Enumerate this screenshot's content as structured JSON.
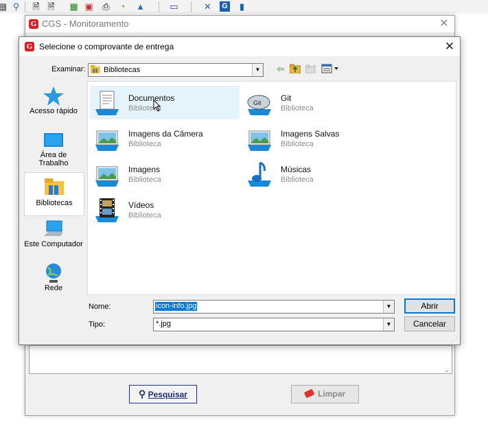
{
  "toolbar": {
    "icons": [
      "document-icon",
      "binoculars-icon",
      "doc-search-icon",
      "doc-gear-icon",
      "doc-report-icon",
      "printer-icon",
      "pie-chart-icon",
      "bell-icon",
      "monitor-icon",
      "tools-icon",
      "cgs-icon",
      "file-icon"
    ]
  },
  "background_window": {
    "title": "CGS - Monitoramento",
    "search_button": "Pesquisar",
    "clear_button": "Limpar"
  },
  "dialog": {
    "title": "Selecione o comprovante de entrega",
    "look_in_label": "Examinar:",
    "look_in_value": "Bibliotecas",
    "places": [
      {
        "label": "Acesso rápido",
        "icon": "star-icon"
      },
      {
        "label": "Área de\nTrabalho",
        "icon": "desktop-icon"
      },
      {
        "label": "Bibliotecas",
        "icon": "libraries-icon"
      },
      {
        "label": "Este Computador",
        "icon": "computer-icon"
      },
      {
        "label": "Rede",
        "icon": "network-icon"
      }
    ],
    "items": [
      {
        "name": "Documentos",
        "type": "Biblioteca",
        "icon": "documents-library-icon"
      },
      {
        "name": "Git",
        "type": "Biblioteca",
        "icon": "git-library-icon"
      },
      {
        "name": "Imagens da Câmera",
        "type": "Biblioteca",
        "icon": "camera-roll-library-icon"
      },
      {
        "name": "Imagens Salvas",
        "type": "Biblioteca",
        "icon": "saved-pictures-library-icon"
      },
      {
        "name": "Imagens",
        "type": "Biblioteca",
        "icon": "pictures-library-icon"
      },
      {
        "name": "Músicas",
        "type": "Biblioteca",
        "icon": "music-library-icon"
      },
      {
        "name": "Vídeos",
        "type": "Biblioteca",
        "icon": "videos-library-icon"
      }
    ],
    "filename_label": "Nome:",
    "filename_value": "icon-info.jpg",
    "filetype_label": "Tipo:",
    "filetype_value": "*.jpg",
    "open_button": "Abrir",
    "cancel_button": "Cancelar"
  },
  "colors": {
    "accent": "#0078d7",
    "brand": "#d61f26",
    "selection": "#e5f3fb"
  }
}
